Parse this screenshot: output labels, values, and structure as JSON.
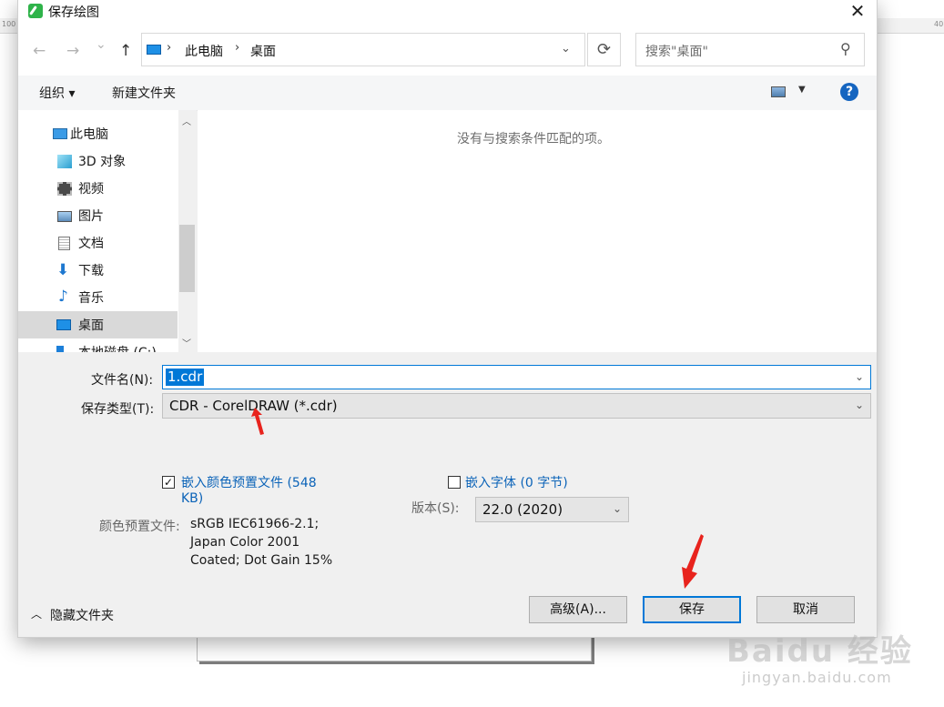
{
  "background": {
    "ruler_left": "100",
    "ruler_right": "40"
  },
  "dialog": {
    "title": "保存绘图",
    "close_icon": "✕"
  },
  "nav": {
    "back_icon": "←",
    "forward_icon": "→",
    "recent_icon": "⌄",
    "up_icon": "↑",
    "breadcrumb": [
      "此电脑",
      "桌面"
    ],
    "search_placeholder": "搜索\"桌面\""
  },
  "toolbar": {
    "organize": "组织 ▾",
    "new_folder": "新建文件夹",
    "help": "?"
  },
  "sidebar": {
    "items": [
      {
        "label": "此电脑",
        "icon": "computer-icon"
      },
      {
        "label": "3D 对象",
        "icon": "3d-objects-icon"
      },
      {
        "label": "视频",
        "icon": "video-icon"
      },
      {
        "label": "图片",
        "icon": "pictures-icon"
      },
      {
        "label": "文档",
        "icon": "documents-icon"
      },
      {
        "label": "下载",
        "icon": "download-icon"
      },
      {
        "label": "音乐",
        "icon": "music-icon"
      },
      {
        "label": "桌面",
        "icon": "desktop-icon",
        "selected": true
      },
      {
        "label": "本地磁盘 (C:)",
        "icon": "drive-icon"
      }
    ]
  },
  "filelist": {
    "empty_message": "没有与搜索条件匹配的项。"
  },
  "form": {
    "filename_label": "文件名(N):",
    "filename_value": "1.cdr",
    "filetype_label": "保存类型(T):",
    "filetype_value": "CDR - CorelDRAW (*.cdr)",
    "embed_profile_line1": "嵌入颜色预置文件 (548",
    "embed_profile_line2": "KB)",
    "embed_profile_checked": true,
    "profile_label": "颜色预置文件:",
    "profile_line1": "sRGB IEC61966-2.1;",
    "profile_line2": "Japan Color 2001",
    "profile_line3": "Coated; Dot Gain 15%",
    "embed_fonts": "嵌入字体 (0 字节)",
    "embed_fonts_checked": false,
    "version_label": "版本(S):",
    "version_value": "22.0 (2020)"
  },
  "footer": {
    "hide_folders": "隐藏文件夹",
    "advanced_button": "高级(A)...",
    "save_button": "保存",
    "cancel_button": "取消"
  },
  "watermark": {
    "main": "Baidu 经验",
    "sub": "jingyan.baidu.com"
  },
  "colors": {
    "accent": "#0078d7",
    "annotation_arrow": "#e8231d"
  }
}
